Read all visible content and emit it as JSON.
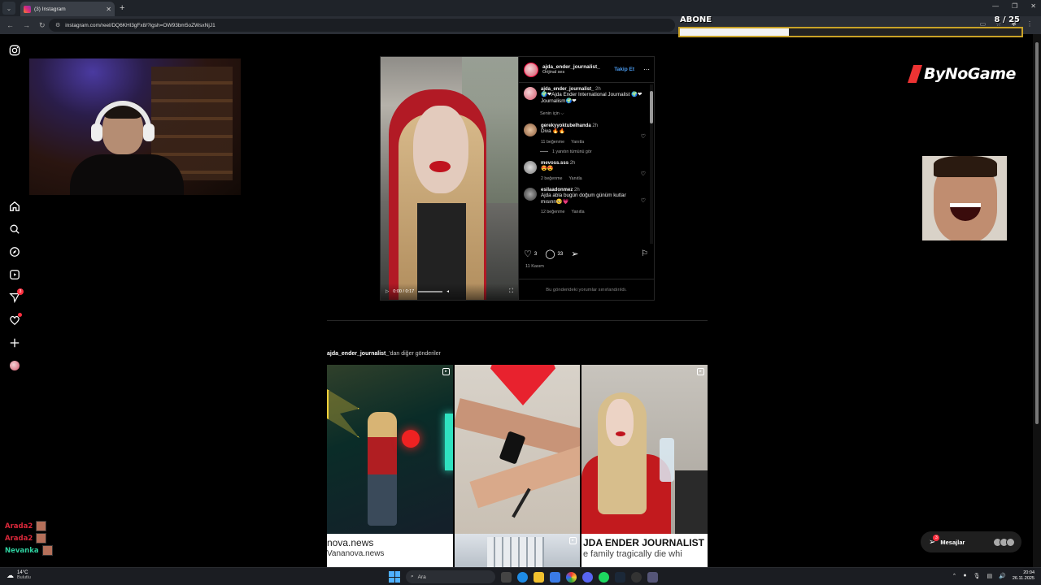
{
  "browser": {
    "tab_title": "(3) Instagram",
    "url": "instagram.com/reel/DQ6KHl3gFx8/?igsh=OW93bm5oZWsxNjJ1"
  },
  "overlay": {
    "sub_goal_label": "ABONE",
    "sub_goal_count": "8 / 25",
    "sub_goal_fraction": 0.32,
    "logo_text": "ByNoGame"
  },
  "ig_sidebar": {
    "icons": [
      "instagram-icon",
      "home-icon",
      "search-icon",
      "explore-icon",
      "reels-icon",
      "messages-icon",
      "notifications-icon",
      "create-icon",
      "profile-icon"
    ],
    "messages_badge": "3"
  },
  "post": {
    "username": "ajda_ender_journalist_",
    "audio": "Orijinal ses",
    "follow_label": "Takip Et",
    "video_time": "0:00 / 0:17",
    "caption": {
      "username": "ajda_ender_journalist_",
      "time": "2h",
      "text": "🌍❤Ajda Ender International Journalist 🌍❤Journalism🌍❤"
    },
    "for_you": "Senin için ⌵",
    "comments": [
      {
        "user": "gerekyyoktubelhanda",
        "time": "2h",
        "text": "Diva 🔥🔥",
        "likes": "11 beğenme",
        "reply": "Yanıtla",
        "view_replies": "1 yanıtın tümünü gör"
      },
      {
        "user": "mevoss.sss",
        "time": "2h",
        "text": "😍😍",
        "likes": "2 beğenme",
        "reply": "Yanıtla",
        "view_replies": ""
      },
      {
        "user": "esilaadonmez",
        "time": "2h",
        "text": "Ajda abla bugün doğum günüm kutlar mısınn🥺💗",
        "likes": "12 beğenme",
        "reply": "Yanıtla",
        "view_replies": ""
      }
    ],
    "like_count": "3",
    "comment_count": "33",
    "date": "11 Kasım",
    "comments_limited": "Bu gönderideki yorumlar sınırlandırıldı."
  },
  "more_posts": {
    "username": "ajda_ender_journalist_",
    "suffix": "'dan diğer gönderiler",
    "tile4_line1": "nova.news",
    "tile4_line2": "Vananova.news",
    "tile6_line1": "JDA ENDER JOURNALIST",
    "tile6_line2": "e family tragically die whi"
  },
  "messages_pill": {
    "label": "Mesajlar",
    "badge": "3"
  },
  "chat": [
    {
      "name": "Arada2",
      "color": "#d9283a"
    },
    {
      "name": "Arada2",
      "color": "#d9283a"
    },
    {
      "name": "Nevanka",
      "color": "#2fd1a0"
    }
  ],
  "taskbar": {
    "temp": "14°C",
    "weather": "Bulutlu",
    "search_placeholder": "Ara",
    "time": "20:04",
    "date": "26.11.2025"
  }
}
